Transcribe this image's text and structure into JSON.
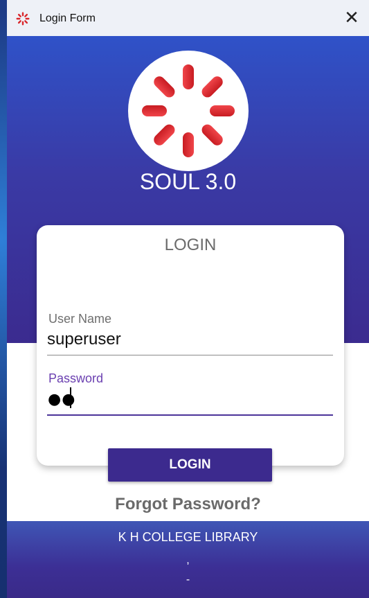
{
  "window": {
    "title": "Login Form",
    "close_glyph": "✕"
  },
  "app": {
    "name": "SOUL 3.0",
    "logo_icon": "spinner-logo-icon",
    "accent_red": "#e0262b",
    "header_blue": "#3b2b8f"
  },
  "login_card": {
    "title": "LOGIN",
    "username": {
      "label": "User Name",
      "value": "superuser"
    },
    "password": {
      "label": "Password",
      "masked_value": "●●"
    }
  },
  "login_button": {
    "label": "LOGIN"
  },
  "forgot_password": {
    "label": "Forgot Password?"
  },
  "footer": {
    "institution": "K H COLLEGE LIBRARY",
    "line2": ",",
    "line3": "-"
  }
}
